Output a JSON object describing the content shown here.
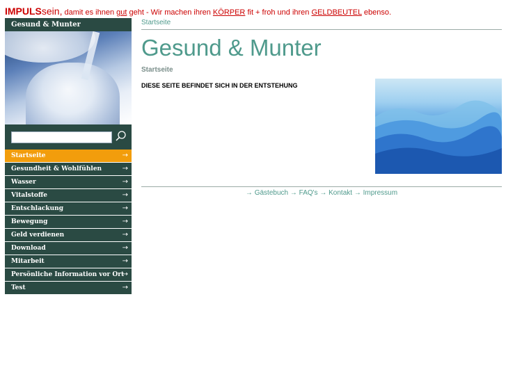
{
  "header": {
    "brand_bold": "IMPULS",
    "brand_rest": "sein,",
    "text_1": " damit es ihnen ",
    "link_gut": "gut",
    "text_2": " geht  - Wir machen ihren ",
    "link_koerper": "KÖRPER",
    "text_3": " fit + froh und ihren ",
    "link_geldbeutel": "GELDBEUTEL",
    "text_4": " ebenso."
  },
  "sidebar": {
    "site_name": "Gesund & Munter",
    "search": {
      "value": "",
      "placeholder": ""
    },
    "items": [
      {
        "label": "Startseite",
        "active": true
      },
      {
        "label": "Gesundheit & Wohlfühlen"
      },
      {
        "label": "Wasser"
      },
      {
        "label": "Vitalstoffe"
      },
      {
        "label": "Entschlackung"
      },
      {
        "label": "Bewegung"
      },
      {
        "label": "Geld verdienen"
      },
      {
        "label": "Download"
      },
      {
        "label": "Mitarbeit"
      },
      {
        "label": "Persönliche Information vor Ort"
      },
      {
        "label": "Test"
      }
    ],
    "arrow": "→"
  },
  "main": {
    "breadcrumb": "Startseite",
    "title": "Gesund & Munter",
    "sub_breadcrumb": "Startseite",
    "notice": "DIESE SEITE BEFINDET SICH IN DER ENTSTEHUNG"
  },
  "footer": {
    "links": [
      "Gästebuch",
      "FAQ's",
      "Kontakt",
      "Impressum"
    ],
    "arrow": "→"
  },
  "colors": {
    "accent_red": "#cc0000",
    "nav_green": "#2a4a43",
    "active_orange": "#f29d0c",
    "teal_text": "#4f9a8c"
  }
}
